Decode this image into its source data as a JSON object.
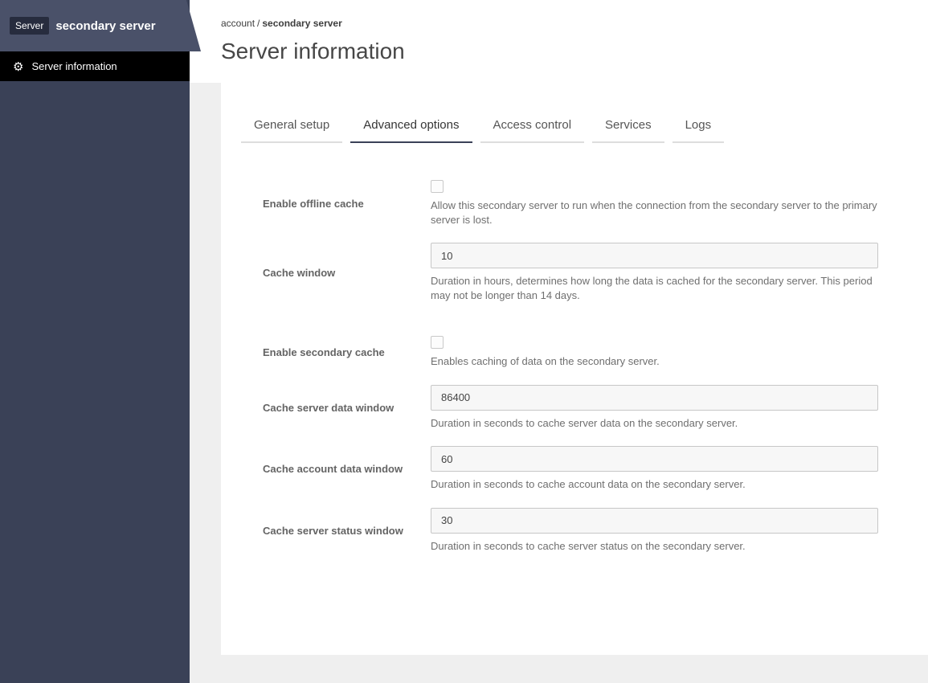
{
  "sidebar": {
    "badge": "Server",
    "title": "secondary server",
    "nav_item": {
      "label": "Server information",
      "icon": "gear-icon"
    }
  },
  "breadcrumb": {
    "parent": "account",
    "separator": "/",
    "current": "secondary server"
  },
  "page": {
    "title": "Server information"
  },
  "tabs": [
    {
      "label": "General setup",
      "active": false
    },
    {
      "label": "Advanced options",
      "active": true
    },
    {
      "label": "Access control",
      "active": false
    },
    {
      "label": "Services",
      "active": false
    },
    {
      "label": "Logs",
      "active": false
    }
  ],
  "form": {
    "rows": [
      {
        "type": "checkbox",
        "label": "Enable offline cache",
        "checked": false,
        "description": "Allow this secondary server to run when the connection from the secondary server to the primary server is lost."
      },
      {
        "type": "text",
        "label": "Cache window",
        "value": "10",
        "description": "Duration in hours, determines how long the data is cached for the secondary server. This period may not be longer than 14 days."
      },
      {
        "type": "checkbox",
        "label": "Enable secondary cache",
        "checked": false,
        "description": "Enables caching of data on the secondary server."
      },
      {
        "type": "text",
        "label": "Cache server data window",
        "value": "86400",
        "description": "Duration in seconds to cache server data on the secondary server."
      },
      {
        "type": "text",
        "label": "Cache account data window",
        "value": "60",
        "description": "Duration in seconds to cache account data on the secondary server."
      },
      {
        "type": "text",
        "label": "Cache server status window",
        "value": "30",
        "description": "Duration in seconds to cache server status on the secondary server."
      }
    ]
  },
  "colors": {
    "sidebar_bg": "#3a4157",
    "sidebar_header_bg": "#4a5169",
    "badge_bg": "#272c3e",
    "nav_bar_bg": "#000000",
    "active_tab_underline": "#3a4157",
    "content_backdrop": "#efefef",
    "input_bg": "#f7f7f7"
  },
  "icons": {
    "gear": "⚙"
  }
}
